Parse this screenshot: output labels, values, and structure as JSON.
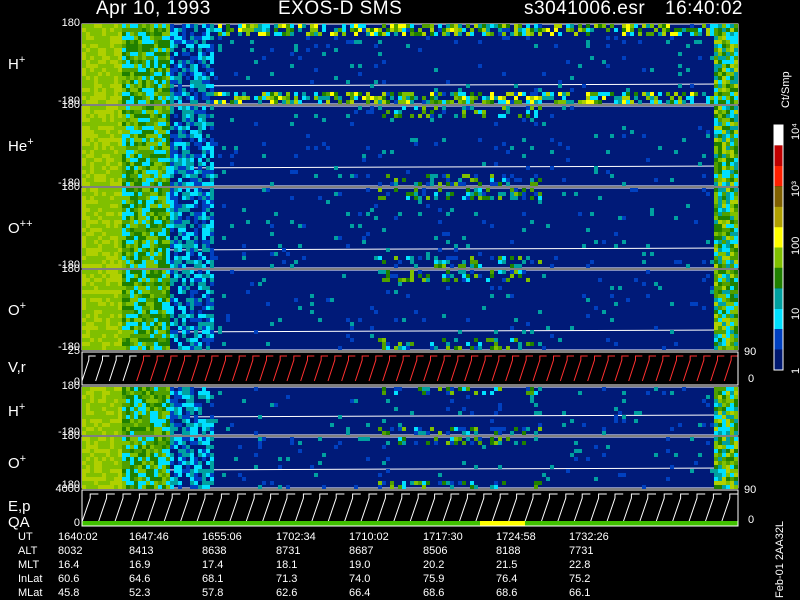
{
  "header": {
    "date": "Apr 10, 1993",
    "instrument": "EXOS-D SMS",
    "file": "s3041006.esr",
    "time": "16:40:02"
  },
  "panels": [
    {
      "label": "H",
      "sup": "+",
      "top": "180",
      "bottom": "-180"
    },
    {
      "label": "He",
      "sup": "+",
      "top": "180",
      "bottom": "-180"
    },
    {
      "label": "O",
      "sup": "++",
      "top": "180",
      "bottom": "-180"
    },
    {
      "label": "O",
      "sup": "+",
      "top": "180",
      "bottom": "-180"
    },
    {
      "label": "V,r",
      "sup": "",
      "top": "25",
      "bottom": "0",
      "right_top": "90",
      "right_bottom": "0"
    },
    {
      "label": "H",
      "sup": "+",
      "top": "180",
      "bottom": "-180"
    },
    {
      "label": "O",
      "sup": "+",
      "top": "180",
      "bottom": "-180"
    },
    {
      "label": "E,p",
      "label2": "QA",
      "sup": "",
      "top": "4000",
      "bottom": "0",
      "right_top": "90",
      "right_bottom": "0"
    }
  ],
  "colorbar": {
    "unit": "Ct/Smp",
    "ticks": [
      "10⁴",
      "10³",
      "100",
      "10",
      "1"
    ],
    "colors": [
      "#ffffff",
      "#c00000",
      "#ff2000",
      "#806000",
      "#b0a000",
      "#ffff00",
      "#80c000",
      "#208000",
      "#00a0a0",
      "#00e0ff",
      "#0040c0",
      "#001870"
    ]
  },
  "side_label": "Feb-01 2AA32L",
  "chart_data": {
    "type": "heatmap",
    "title": "Apr 10, 1993   EXOS-D SMS",
    "x_label": "UT",
    "x_ticks": [
      "1640:02",
      "1647:46",
      "1655:06",
      "1702:34",
      "1710:02",
      "1717:30",
      "1724:58",
      "1732:26"
    ],
    "ylim": [
      -180,
      180
    ],
    "color_scale": "log",
    "color_range": [
      1,
      10000
    ],
    "color_label": "Ct/Smp",
    "orbit": {
      "rows": [
        "ALT",
        "MLT",
        "InLat",
        "MLat"
      ],
      "ALT": [
        8032,
        8413,
        8638,
        8731,
        8687,
        8506,
        8188,
        7731
      ],
      "MLT": [
        16.4,
        16.9,
        17.4,
        18.1,
        19.0,
        20.2,
        21.5,
        22.8
      ],
      "InLat": [
        60.6,
        64.6,
        68.1,
        71.3,
        74.0,
        75.9,
        76.4,
        75.2
      ],
      "MLat": [
        45.8,
        52.3,
        57.8,
        62.6,
        66.4,
        68.6,
        68.6,
        66.1
      ]
    }
  }
}
